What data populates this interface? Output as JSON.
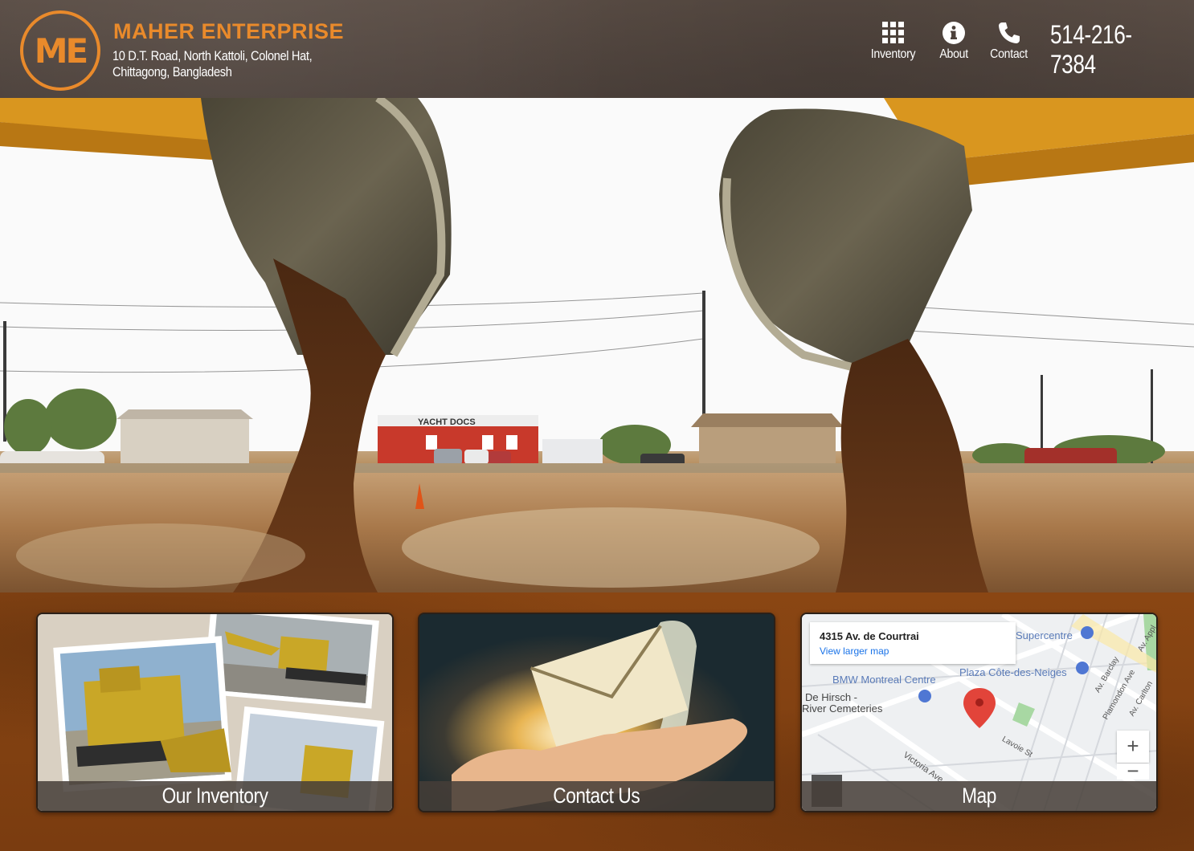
{
  "header": {
    "logo_text": "ME",
    "brand_name": "MAHER ENTERPRISE",
    "address_line1": "10 D.T. Road, North Kattoli, Colonel Hat,",
    "address_line2": "Chittagong, Bangladesh",
    "phone": "514-216-7384",
    "nav": [
      {
        "label": "Inventory",
        "icon": "grid-icon"
      },
      {
        "label": "About",
        "icon": "info-icon"
      },
      {
        "label": "Contact",
        "icon": "phone-icon"
      }
    ]
  },
  "hero": {
    "sign_text": "YACHT DOCS"
  },
  "cards": [
    {
      "caption": "Our Inventory"
    },
    {
      "caption": "Contact Us"
    },
    {
      "caption": "Map"
    }
  ],
  "map": {
    "address": "4315 Av. de Courtrai",
    "link": "View larger map",
    "places": [
      "Supercentre",
      "Plaza Côte-des-Neiges",
      "BMW Montreal Centre",
      "De Hirsch -",
      "River Cemeteries"
    ],
    "streets": [
      "Victoria Ave",
      "Lavoie St",
      "Av. Barclay",
      "Av. Carlton",
      "Plamondon Ave",
      "Av. Appl"
    ],
    "zoom_in": "+",
    "zoom_out": "−"
  },
  "colors": {
    "brand": "#e98a2b",
    "header_bg": "#4c413b",
    "band_bg": "#7a3c10"
  }
}
